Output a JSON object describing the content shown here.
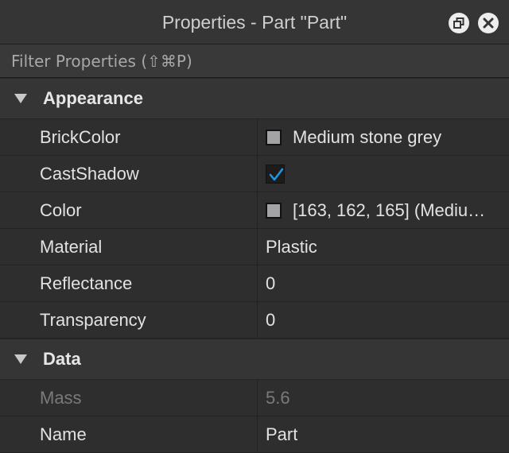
{
  "window": {
    "title": "Properties - Part \"Part\""
  },
  "filter": {
    "placeholder": "Filter Properties (⇧⌘P)"
  },
  "sections": {
    "appearance": {
      "label": "Appearance",
      "rows": {
        "brickcolor": {
          "name": "BrickColor",
          "value": "Medium stone grey",
          "swatch": "#a3a2a5"
        },
        "castshadow": {
          "name": "CastShadow",
          "checked": true,
          "check_color": "#1c98e8"
        },
        "color": {
          "name": "Color",
          "value": "[163, 162, 165] (Mediu…",
          "swatch": "#a3a2a5"
        },
        "material": {
          "name": "Material",
          "value": "Plastic"
        },
        "reflectance": {
          "name": "Reflectance",
          "value": "0"
        },
        "transparency": {
          "name": "Transparency",
          "value": "0"
        }
      }
    },
    "data": {
      "label": "Data",
      "rows": {
        "mass": {
          "name": "Mass",
          "value": "5.6",
          "disabled": true
        },
        "name": {
          "name": "Name",
          "value": "Part"
        }
      }
    }
  },
  "icons": {
    "restore": "restore-window-icon",
    "close": "close-icon",
    "collapse": "triangle-down-icon",
    "check": "checkmark-icon"
  }
}
